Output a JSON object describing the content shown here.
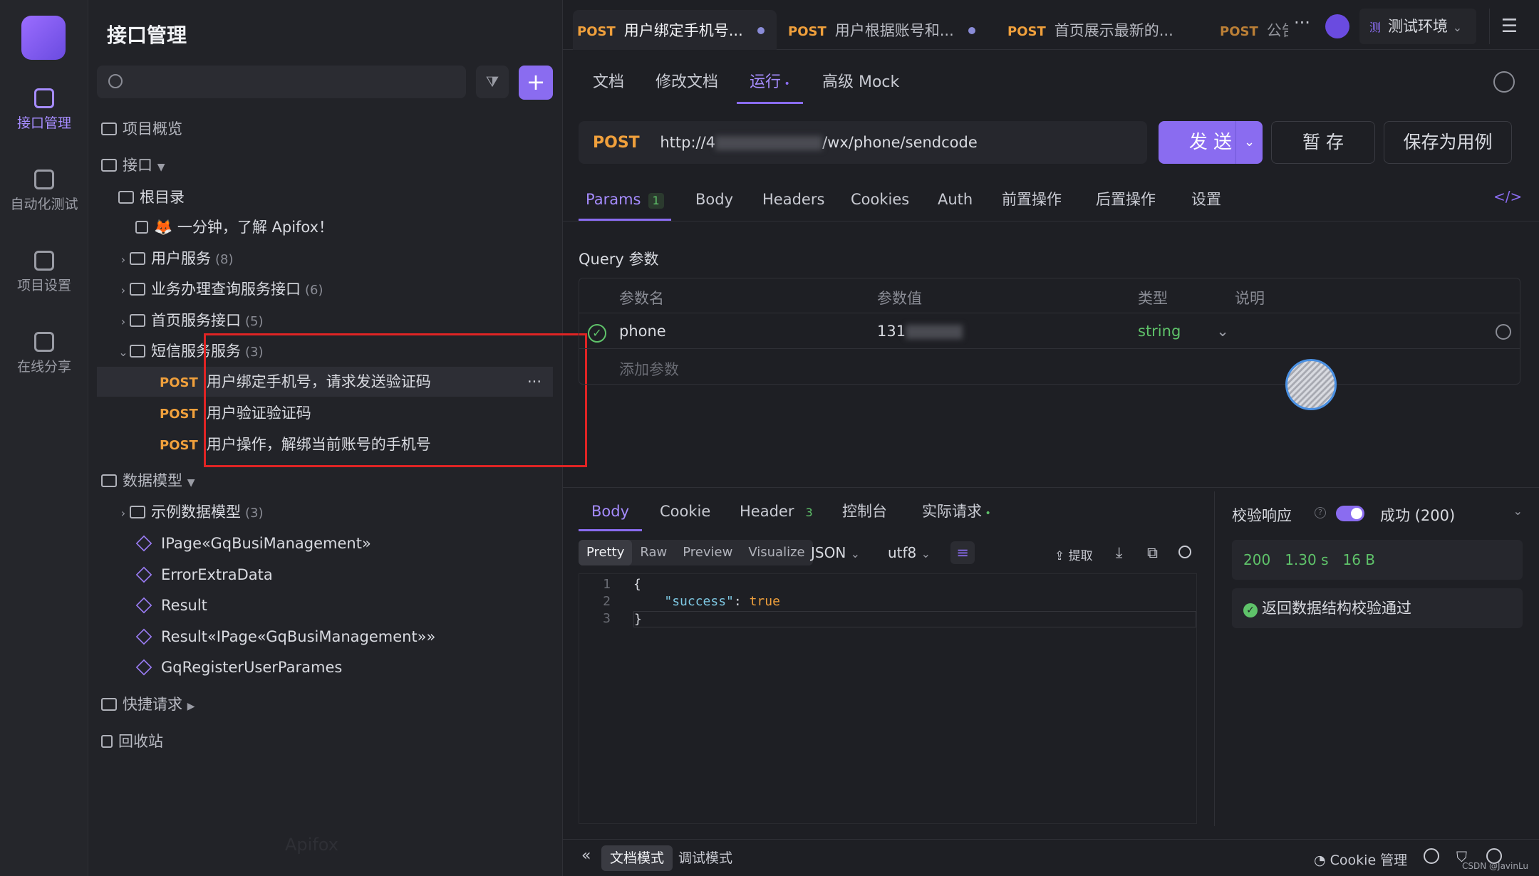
{
  "rail": [
    {
      "label": "接口管理",
      "icon": "api-icon",
      "active": true
    },
    {
      "label": "自动化测试",
      "icon": "automation-icon",
      "active": false
    },
    {
      "label": "项目设置",
      "icon": "settings-icon",
      "active": false
    },
    {
      "label": "在线分享",
      "icon": "share-icon",
      "active": false
    }
  ],
  "sidebar": {
    "title": "接口管理",
    "overview": "项目概览",
    "interfaces": "接口",
    "root": "根目录",
    "intro": "🦊 一分钟，了解 Apifox！",
    "folders": [
      {
        "name": "用户服务",
        "count": "(8)"
      },
      {
        "name": "业务办理查询服务接口",
        "count": "(6)"
      },
      {
        "name": "首页服务接口",
        "count": "(5)"
      },
      {
        "name": "短信服务服务",
        "count": "(3)"
      }
    ],
    "sms_items": [
      {
        "method": "POST",
        "name": "用户绑定手机号，请求发送验证码"
      },
      {
        "method": "POST",
        "name": "用户验证验证码"
      },
      {
        "method": "POST",
        "name": "用户操作，解绑当前账号的手机号"
      }
    ],
    "models_label": "数据模型",
    "model_folder": {
      "name": "示例数据模型",
      "count": "(3)"
    },
    "models": [
      "IPage«GqBusiManagement»",
      "ErrorExtraData",
      "Result",
      "Result«IPage«GqBusiManagement»»",
      "GqRegisterUserParames"
    ],
    "quick": "快捷请求",
    "trash": "回收站",
    "watermark": "Apifox"
  },
  "tabs": [
    {
      "method": "POST",
      "name": "用户绑定手机号..."
    },
    {
      "method": "POST",
      "name": "用户根据账号和..."
    },
    {
      "method": "POST",
      "name": "首页展示最新的..."
    },
    {
      "method": "POST",
      "name": "公告"
    }
  ],
  "env": {
    "badge": "测",
    "label": "测试环境"
  },
  "subtabs": [
    "文档",
    "修改文档",
    "运行",
    "高级 Mock"
  ],
  "request": {
    "method": "POST",
    "url_prefix": "http://4",
    "url_suffix": "/wx/phone/sendcode",
    "send": "发 送",
    "save": "暂 存",
    "save_case": "保存为用例"
  },
  "param_tabs": [
    {
      "label": "Params",
      "badge": "1"
    },
    {
      "label": "Body"
    },
    {
      "label": "Headers"
    },
    {
      "label": "Cookies"
    },
    {
      "label": "Auth"
    },
    {
      "label": "前置操作"
    },
    {
      "label": "后置操作"
    },
    {
      "label": "设置"
    }
  ],
  "query": {
    "title": "Query 参数",
    "headers": [
      "参数名",
      "参数值",
      "类型",
      "说明"
    ],
    "row": {
      "name": "phone",
      "value": "131",
      "type": "string"
    },
    "add": "添加参数"
  },
  "response": {
    "tabs": [
      {
        "label": "Body"
      },
      {
        "label": "Cookie"
      },
      {
        "label": "Header",
        "badge": "3"
      },
      {
        "label": "控制台"
      },
      {
        "label": "实际请求"
      }
    ],
    "formats": [
      "Pretty",
      "Raw",
      "Preview",
      "Visualize"
    ],
    "lang": "JSON",
    "encoding": "utf8",
    "extract": "提取",
    "code": [
      "{",
      "    \"success\": true",
      "}"
    ],
    "validate_label": "校验响应",
    "status_select": "成功 (200)",
    "status": "200",
    "time": "1.30 s",
    "size": "16 B",
    "validate_msg": "返回数据结构校验通过"
  },
  "bottom": {
    "doc_mode": "文档模式",
    "debug_mode": "调试模式",
    "cookie": "Cookie 管理",
    "credit": "CSDN @JavinLu"
  }
}
